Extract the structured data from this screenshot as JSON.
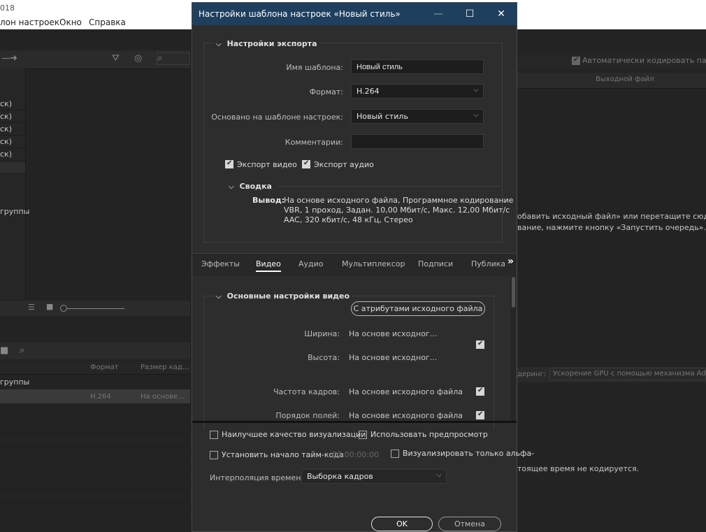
{
  "app": {
    "title_fragment": "018",
    "menu": [
      {
        "label": "лон настроек"
      },
      {
        "label": "Окно"
      },
      {
        "label": "Справка"
      }
    ]
  },
  "left_panel": {
    "queue_rows": [
      "ск)",
      "ск)",
      "ск)",
      "ск)",
      "ск)"
    ],
    "group_label": "группы",
    "lower_headers": {
      "format": "Формат",
      "frame_size": "Размер кад..."
    },
    "lower_group": "группы",
    "lower_row": {
      "format": "H.264",
      "frame_size": "На основе..."
    }
  },
  "right_panel": {
    "auto_encode_label": "Автоматически кодировать папки",
    "output_file_header": "Выходной файл",
    "hint_line1": "обавить исходный файл» или перетащите сюда фай",
    "hint_line2": "вание, нажмите кнопку «Запустить очередь».",
    "renderer_label": "деринг:",
    "renderer_value": "Ускорение GPU с помощью механизма Ad",
    "status_text": "тоящее время не кодируется."
  },
  "dialog": {
    "title": "Настройки шаблона настроек «Новый стиль»",
    "export_section": {
      "heading": "Настройки экспорта",
      "template_name_label": "Имя шаблона:",
      "template_name_value": "Новый стиль",
      "format_label": "Формат:",
      "format_value": "H.264",
      "based_on_label": "Основано на шаблоне настроек:",
      "based_on_value": "Новый стиль",
      "comments_label": "Комментарии:",
      "comments_value": "",
      "export_video_label": "Экспорт видео",
      "export_video_checked": true,
      "export_audio_label": "Экспорт аудио",
      "export_audio_checked": true
    },
    "summary": {
      "heading": "Сводка",
      "output_label": "Вывод:",
      "output_line1": "На основе исходного файла, Программное кодирование",
      "output_line2": "VBR, 1 проход, Задан. 10,00 Мбит/с, Макс. 12,00 Мбит/с",
      "output_line3": "AAC, 320 кбит/с, 48 кГц, Стерео"
    },
    "tabs": [
      {
        "label": "Эффекты",
        "active": false
      },
      {
        "label": "Видео",
        "active": true
      },
      {
        "label": "Аудио",
        "active": false
      },
      {
        "label": "Мультиплексор",
        "active": false
      },
      {
        "label": "Подписи",
        "active": false
      },
      {
        "label": "Публикац",
        "active": false
      }
    ],
    "tabs_overflow": "»",
    "video_section": {
      "heading": "Основные настройки видео",
      "match_source_button": "С атрибутами исходного файла",
      "width_label": "Ширина:",
      "width_value": "На основе исходног...",
      "height_label": "Высота:",
      "height_value": "На основе исходног...",
      "wh_linked_checked": true,
      "framerate_label": "Частота кадров:",
      "framerate_value": "На основе исходного файла",
      "framerate_checked": true,
      "field_order_label": "Порядок полей:",
      "field_order_value": "На основе исходного файла",
      "field_order_checked": true
    },
    "bottom": {
      "max_quality_label": "Наилучшее качество визуализации",
      "max_quality_checked": false,
      "use_previews_label": "Использовать предпросмотр",
      "use_previews_checked": false,
      "set_timecode_label": "Установить начало тайм-кода",
      "set_timecode_checked": false,
      "timecode_value": "00:00:00:00",
      "alpha_only_label": "Визуализировать только альфа-",
      "alpha_only_checked": false,
      "interpolation_label": "Интерполяция времени:",
      "interpolation_value": "Выборка кадров"
    },
    "ok_button": "OK",
    "cancel_button": "Отмена"
  }
}
